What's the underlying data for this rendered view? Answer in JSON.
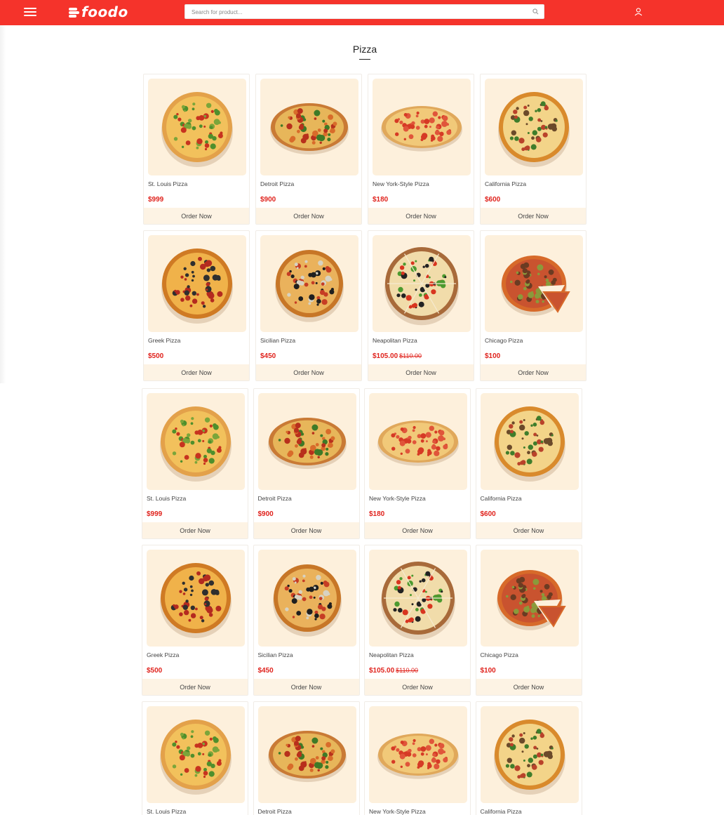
{
  "header": {
    "brand": "foodo",
    "search_placeholder": "Search for product...",
    "colors": {
      "bar": "#f5332b",
      "price": "#e0231d",
      "card_image_bg": "#fdf0dc",
      "order_bg": "#fdf3e4"
    }
  },
  "section": {
    "title": "Pizza"
  },
  "order_label": "Order Now",
  "products": [
    {
      "name": "St. Louis Pizza",
      "price": "$999",
      "old_price": "",
      "icon": "st-louis-pizza"
    },
    {
      "name": "Detroit Pizza",
      "price": "$900",
      "old_price": "",
      "icon": "detroit-pizza"
    },
    {
      "name": "New York-Style Pizza",
      "price": "$180",
      "old_price": "",
      "icon": "new-york-pizza"
    },
    {
      "name": "California Pizza",
      "price": "$600",
      "old_price": "",
      "icon": "california-pizza"
    },
    {
      "name": "Greek Pizza",
      "price": "$500",
      "old_price": "",
      "icon": "greek-pizza"
    },
    {
      "name": "Sicilian Pizza",
      "price": "$450",
      "old_price": "",
      "icon": "sicilian-pizza"
    },
    {
      "name": "Neapolitan Pizza",
      "price": "$105.00",
      "old_price": "$110.00",
      "icon": "neapolitan-pizza"
    },
    {
      "name": "Chicago Pizza",
      "price": "$100",
      "old_price": "",
      "icon": "chicago-pizza"
    }
  ]
}
